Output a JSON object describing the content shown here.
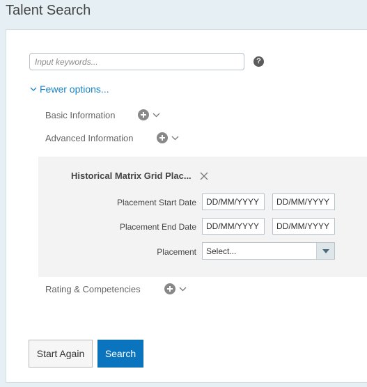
{
  "page": {
    "title": "Talent Search"
  },
  "search": {
    "placeholder": "Input keywords...",
    "help_icon": "help-icon",
    "help_glyph": "?"
  },
  "toggle": {
    "label": "Fewer options..."
  },
  "sections": {
    "basic": "Basic Information",
    "advanced": "Advanced Information",
    "rating": "Rating & Competencies"
  },
  "matrix": {
    "title": "Historical Matrix Grid Plac...",
    "start_label": "Placement Start Date",
    "end_label": "Placement End Date",
    "placement_label": "Placement",
    "date_placeholder": "DD/MM/YYYY",
    "select_value": "Select..."
  },
  "buttons": {
    "start_again": "Start Again",
    "search": "Search"
  },
  "colors": {
    "accent": "#0b74bf",
    "link": "#1b83c5",
    "background": "#e6f0f4"
  }
}
